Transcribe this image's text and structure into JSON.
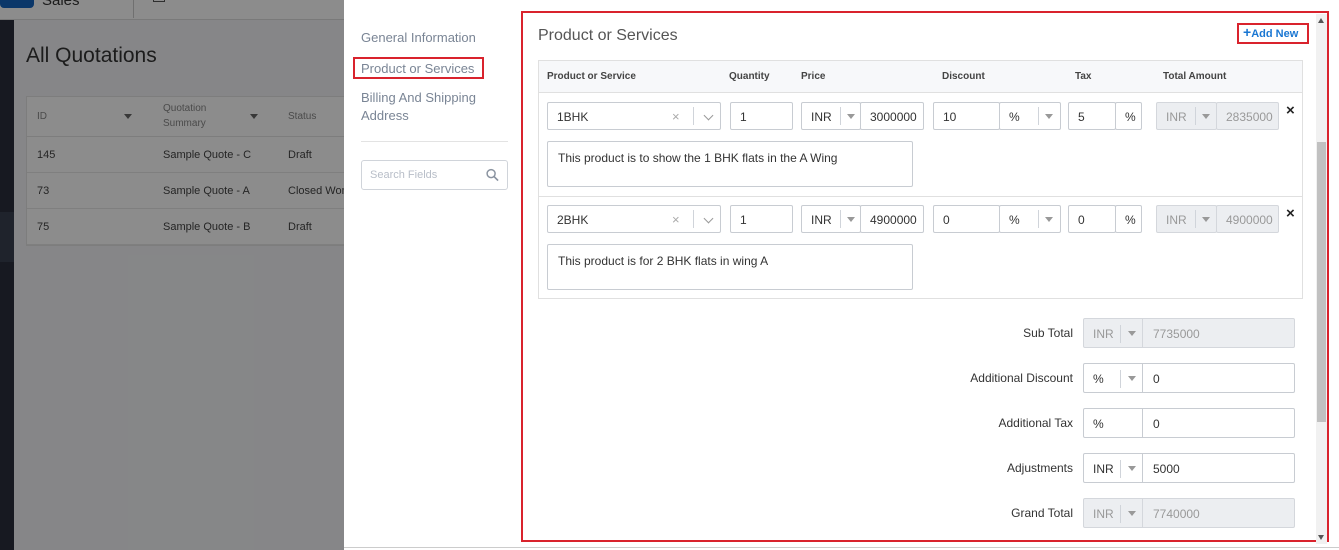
{
  "background": {
    "app_name": "Sales",
    "page_title": "All Quotations",
    "table": {
      "headers": [
        "ID",
        "Quotation Summary",
        "Status"
      ],
      "rows": [
        {
          "id": "145",
          "summary": "Sample Quote - C",
          "status": "Draft"
        },
        {
          "id": "73",
          "summary": "Sample Quote - A",
          "status": "Closed Won"
        },
        {
          "id": "75",
          "summary": "Sample Quote - B",
          "status": "Draft"
        }
      ]
    }
  },
  "nav": {
    "items": [
      "General Information",
      "Product or Services",
      "Billing And Shipping Address"
    ],
    "search_placeholder": "Search Fields"
  },
  "section": {
    "title": "Product or Services",
    "add_new": "Add New",
    "columns": [
      "Product or Service",
      "Quantity",
      "Price",
      "Discount",
      "Tax",
      "Total Amount"
    ]
  },
  "items": [
    {
      "product": "1BHK",
      "quantity": "1",
      "price_currency": "INR",
      "price": "3000000",
      "discount": "10",
      "discount_type": "%",
      "tax": "5",
      "tax_unit": "%",
      "total_currency": "INR",
      "total": "2835000",
      "description": "This product is to show the 1 BHK flats in the A Wing"
    },
    {
      "product": "2BHK",
      "quantity": "1",
      "price_currency": "INR",
      "price": "4900000",
      "discount": "0",
      "discount_type": "%",
      "tax": "0",
      "tax_unit": "%",
      "total_currency": "INR",
      "total": "4900000",
      "description": "This product is for 2 BHK flats in wing A"
    }
  ],
  "totals": {
    "sub_total": {
      "label": "Sub Total",
      "unit": "INR",
      "value": "7735000"
    },
    "additional_discount": {
      "label": "Additional Discount",
      "unit": "%",
      "value": "0"
    },
    "additional_tax": {
      "label": "Additional Tax",
      "unit": "%",
      "value": "0"
    },
    "adjustments": {
      "label": "Adjustments",
      "unit": "INR",
      "value": "5000"
    },
    "grand_total": {
      "label": "Grand Total",
      "unit": "INR",
      "value": "7740000"
    }
  },
  "colors": {
    "highlight": "#d9232d",
    "link": "#1976d2"
  },
  "icons": [
    "search-icon",
    "clear-icon",
    "chevron-down-icon",
    "close-icon",
    "plus-icon"
  ]
}
